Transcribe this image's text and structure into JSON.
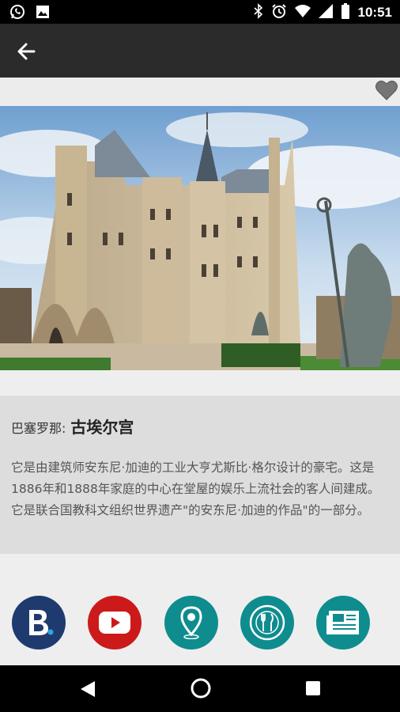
{
  "status_bar": {
    "time": "10:51",
    "left_icons": [
      "whatsapp-icon",
      "image-icon"
    ],
    "right_icons": [
      "bluetooth-icon",
      "alarm-icon",
      "wifi-icon",
      "signal-icon",
      "battery-icon"
    ]
  },
  "app_bar": {
    "back_icon": "arrow-left-icon"
  },
  "favorite": {
    "icon": "heart-icon",
    "color": "#757575"
  },
  "place": {
    "prefix": "巴塞罗那:",
    "name": "古埃尔宫",
    "description": "它是由建筑师安东尼·加迪的工业大亨尤斯比·格尔设计的豪宅。这是1886年和1888年家庭的中心在堂屋的娱乐上流社会的客人间建成。它是联合国教科文组织世界遗产\"的安东尼·加迪的作品\"的一部分。"
  },
  "actions": [
    {
      "name": "booking",
      "icon": "booking-b-icon",
      "color": "#1f3a6e"
    },
    {
      "name": "youtube",
      "icon": "youtube-play-icon",
      "color": "#cc1a1a"
    },
    {
      "name": "location",
      "icon": "map-pin-icon",
      "color": "#0f8c8e"
    },
    {
      "name": "restaurant",
      "icon": "plate-cutlery-icon",
      "color": "#0f8c8e"
    },
    {
      "name": "news",
      "icon": "newspaper-icon",
      "color": "#0f8c8e"
    }
  ],
  "nav_bar": {
    "icons": [
      "back-triangle-icon",
      "home-circle-icon",
      "recents-square-icon"
    ]
  }
}
